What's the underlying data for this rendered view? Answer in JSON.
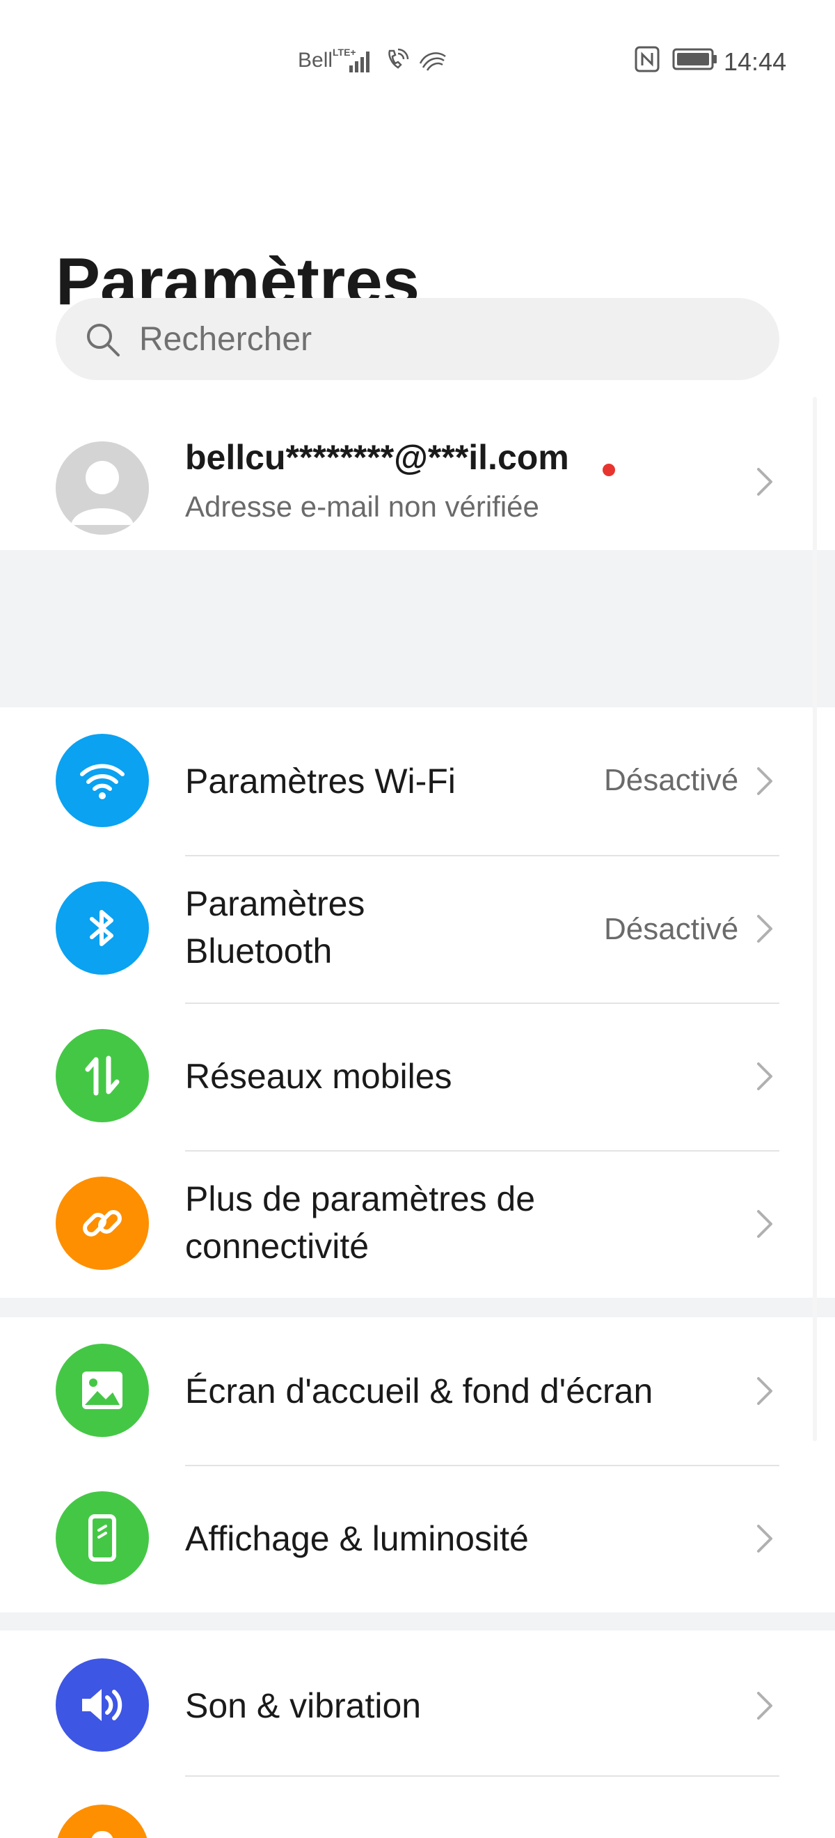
{
  "status_bar": {
    "carrier": "Bell",
    "network": "LTE+",
    "time": "14:44",
    "icons": [
      "signal-icon",
      "wifi-calling-icon",
      "swype-icon",
      "nfc-icon",
      "battery-icon"
    ]
  },
  "header": {
    "title": "Paramètres"
  },
  "search": {
    "placeholder": "Rechercher"
  },
  "account": {
    "email": "bellcu********@***il.com",
    "subtitle": "Adresse e-mail non vérifiée"
  },
  "groups": [
    {
      "items": [
        {
          "label": "Paramètres Wi-Fi",
          "status": "Désactivé",
          "icon": "wifi-icon",
          "color": "#0aa2f1"
        },
        {
          "label_line1": "Paramètres",
          "label_line2": "Bluetooth",
          "status": "Désactivé",
          "icon": "bluetooth-icon",
          "color": "#0aa2f1"
        },
        {
          "label": "Réseaux mobiles",
          "icon": "mobile-data-icon",
          "color": "#45c746"
        },
        {
          "label_line1": "Plus de paramètres de",
          "label_line2": "connectivité",
          "icon": "link-icon",
          "color": "#fd8f00"
        }
      ]
    },
    {
      "items": [
        {
          "label": "Écran d'accueil & fond d'écran",
          "icon": "wallpaper-icon",
          "color": "#45c746"
        },
        {
          "label": "Affichage & luminosité",
          "icon": "display-icon",
          "color": "#45c746"
        }
      ]
    },
    {
      "items": [
        {
          "label": "Son & vibration",
          "icon": "sound-icon",
          "color": "#3e56e4"
        },
        {
          "label": "",
          "icon": "notification-icon",
          "color": "#fd8f00"
        }
      ]
    }
  ]
}
